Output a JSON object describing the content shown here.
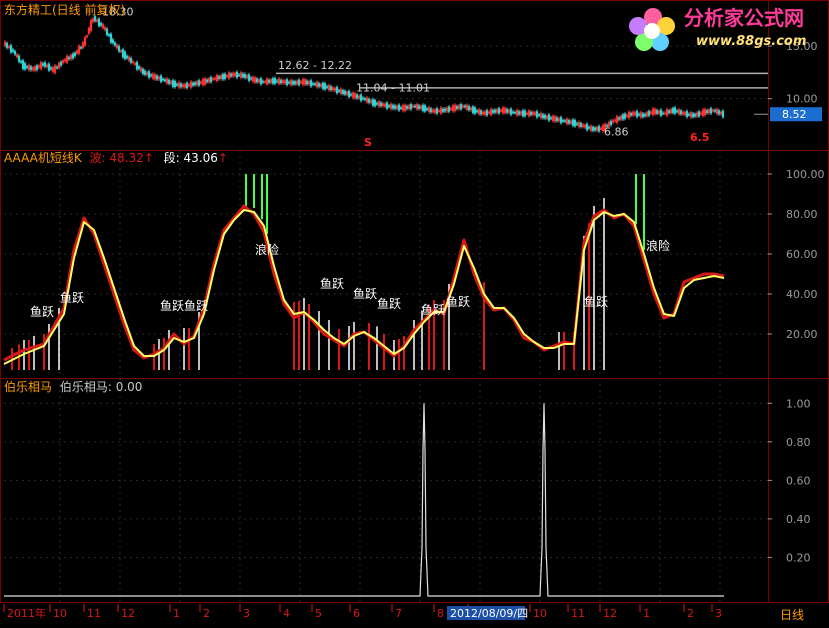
{
  "window": {
    "title": "东方精工(日线 前复权)"
  },
  "watermark": {
    "text": "分析家公式网",
    "url": "www.88gs.com"
  },
  "colors": {
    "background": "#000000",
    "panel_border": "#7a0000",
    "grid": "#2a2a2a",
    "axis_text": "#9a9a9a",
    "title_text": "#ff9900",
    "line_red": "#d81818",
    "line_yellow": "#ffff66",
    "bar_white": "#ffffff",
    "bar_green": "#44ff44",
    "candle_up": "#ff3030",
    "candle_down": "#2ed2d2",
    "ref_line": "#b0b0b0",
    "price_box": "#1c6dd0"
  },
  "chart_data": [
    {
      "type": "line",
      "title": "东方精工(日线 前复权)",
      "ylim": [
        5.5,
        19.0
      ],
      "y_ticks": [
        "15.00",
        "10.00"
      ],
      "current_price": "8.52",
      "annotations": [
        "18.30",
        "12.62 - 12.22",
        "11.04 - 11.01",
        "6.86",
        "S",
        "6.5"
      ],
      "x": [
        0,
        10,
        20,
        30,
        40,
        50,
        60,
        70,
        80,
        90,
        100,
        110,
        120,
        130,
        140,
        150,
        160,
        170,
        180,
        190,
        200,
        210,
        220,
        230,
        240,
        250,
        260,
        270,
        280,
        290,
        300,
        310,
        320,
        330,
        340,
        350,
        360,
        370,
        380,
        390,
        400,
        410,
        420,
        430,
        440,
        450,
        460,
        470,
        480,
        490,
        500,
        510,
        520,
        530,
        540,
        550,
        560,
        570,
        580,
        590,
        600,
        610,
        620,
        630,
        640,
        650,
        660,
        670,
        680,
        690,
        700,
        710,
        720
      ],
      "values": [
        15.3,
        14.5,
        13.1,
        12.8,
        13.3,
        12.7,
        13.6,
        14.1,
        15.2,
        17.7,
        16.8,
        15.3,
        14.2,
        13.4,
        12.5,
        12.1,
        11.8,
        11.4,
        11.2,
        11.4,
        11.6,
        11.9,
        12.1,
        12.3,
        12.2,
        11.8,
        11.6,
        11.7,
        11.6,
        11.5,
        11.6,
        11.4,
        11.2,
        10.9,
        10.6,
        10.3,
        10.0,
        9.6,
        9.4,
        9.2,
        9.1,
        9.3,
        9.1,
        8.8,
        8.9,
        9.1,
        9.3,
        8.9,
        8.6,
        8.8,
        8.9,
        8.7,
        8.6,
        8.6,
        8.3,
        8.1,
        7.9,
        7.7,
        7.4,
        7.1,
        7.2,
        7.9,
        8.3,
        8.6,
        8.4,
        8.8,
        8.6,
        8.9,
        8.6,
        8.4,
        8.7,
        8.9,
        8.5
      ]
    },
    {
      "type": "line",
      "title": "AAAA机短线K",
      "legend": [
        {
          "label": "波:",
          "value": "48.32",
          "color": "#d81818"
        },
        {
          "label": "段:",
          "value": "43.06",
          "color": "#ffffff"
        }
      ],
      "ylim": [
        0,
        110
      ],
      "y_ticks": [
        "100.00",
        "80.00",
        "60.00",
        "40.00",
        "20.00"
      ],
      "x": [
        0,
        20,
        40,
        60,
        70,
        80,
        90,
        100,
        110,
        120,
        130,
        140,
        150,
        160,
        170,
        180,
        190,
        200,
        210,
        220,
        230,
        240,
        250,
        260,
        270,
        280,
        290,
        300,
        310,
        320,
        330,
        340,
        350,
        360,
        370,
        380,
        390,
        400,
        410,
        420,
        430,
        440,
        450,
        460,
        470,
        480,
        490,
        500,
        510,
        520,
        530,
        540,
        550,
        560,
        570,
        580,
        590,
        600,
        610,
        620,
        630,
        640,
        650,
        660,
        670,
        680,
        690,
        700,
        710,
        720
      ],
      "series": [
        {
          "name": "波",
          "values": [
            7,
            12,
            15,
            33,
            62,
            78,
            70,
            55,
            40,
            25,
            12,
            8,
            10,
            13,
            20,
            15,
            19,
            33,
            55,
            72,
            78,
            84,
            80,
            71,
            50,
            35,
            28,
            31,
            26,
            20,
            17,
            14,
            20,
            21,
            17,
            13,
            9,
            14,
            22,
            27,
            32,
            30,
            48,
            67,
            50,
            38,
            32,
            33,
            27,
            18,
            16,
            12,
            14,
            16,
            15,
            66,
            79,
            82,
            78,
            80,
            74,
            57,
            40,
            28,
            30,
            46,
            48,
            50,
            50,
            49
          ],
          "color": "#d81818"
        },
        {
          "name": "段",
          "values": [
            5,
            10,
            14,
            30,
            58,
            76,
            72,
            58,
            43,
            28,
            14,
            9,
            9,
            12,
            18,
            16,
            18,
            30,
            52,
            70,
            77,
            82,
            81,
            74,
            54,
            37,
            30,
            31,
            27,
            22,
            18,
            15,
            19,
            21,
            18,
            14,
            10,
            13,
            20,
            26,
            31,
            31,
            45,
            64,
            53,
            40,
            33,
            33,
            28,
            20,
            16,
            13,
            13,
            15,
            15,
            62,
            77,
            81,
            79,
            80,
            76,
            60,
            43,
            30,
            29,
            43,
            47,
            48,
            49,
            48
          ],
          "color": "#ffff66"
        }
      ],
      "markers": [
        {
          "label": "鱼跃",
          "x": 38,
          "y": 29
        },
        {
          "label": "鱼跃",
          "x": 68,
          "y": 36
        },
        {
          "label": "鱼跃",
          "x": 168,
          "y": 32
        },
        {
          "label": "鱼跃",
          "x": 192,
          "y": 32
        },
        {
          "label": "浪险",
          "x": 263,
          "y": 60
        },
        {
          "label": "鱼跃",
          "x": 328,
          "y": 43
        },
        {
          "label": "鱼跃",
          "x": 361,
          "y": 38
        },
        {
          "label": "鱼跃",
          "x": 385,
          "y": 33
        },
        {
          "label": "鱼跃",
          "x": 429,
          "y": 30
        },
        {
          "label": "鱼跃",
          "x": 454,
          "y": 34
        },
        {
          "label": "鱼跃",
          "x": 592,
          "y": 34
        },
        {
          "label": "浪险",
          "x": 654,
          "y": 62
        }
      ],
      "bars_white": [
        20,
        30,
        45,
        55,
        155,
        165,
        180,
        195,
        300,
        315,
        325,
        345,
        350,
        373,
        390,
        410,
        418,
        445,
        555,
        580,
        590,
        600
      ],
      "bars_red": [
        8,
        15,
        25,
        40,
        150,
        160,
        185,
        290,
        295,
        305,
        335,
        365,
        380,
        395,
        400,
        425,
        430,
        440,
        480,
        560,
        570,
        585
      ],
      "bars_green": [
        242,
        250,
        258,
        263,
        632,
        640
      ]
    },
    {
      "type": "line",
      "title": "伯乐相马",
      "legend": [
        {
          "label": "伯乐相马:",
          "value": "0.00"
        }
      ],
      "ylim": [
        0,
        1.1
      ],
      "y_ticks": [
        "1.00",
        "0.80",
        "0.60",
        "0.40",
        "0.20"
      ],
      "spikes_x": [
        420,
        540
      ],
      "values": [
        0,
        1.0,
        0.76,
        0.25,
        0
      ]
    }
  ],
  "time_axis": {
    "labels": [
      "2011年",
      "10",
      "11",
      "12",
      "1",
      "2",
      "3",
      "4",
      "5",
      "6",
      "7",
      "8",
      "9",
      "10",
      "11",
      "12",
      "1",
      "2",
      "3"
    ],
    "selected_date": "2012/08/09/四",
    "period": "日线"
  }
}
